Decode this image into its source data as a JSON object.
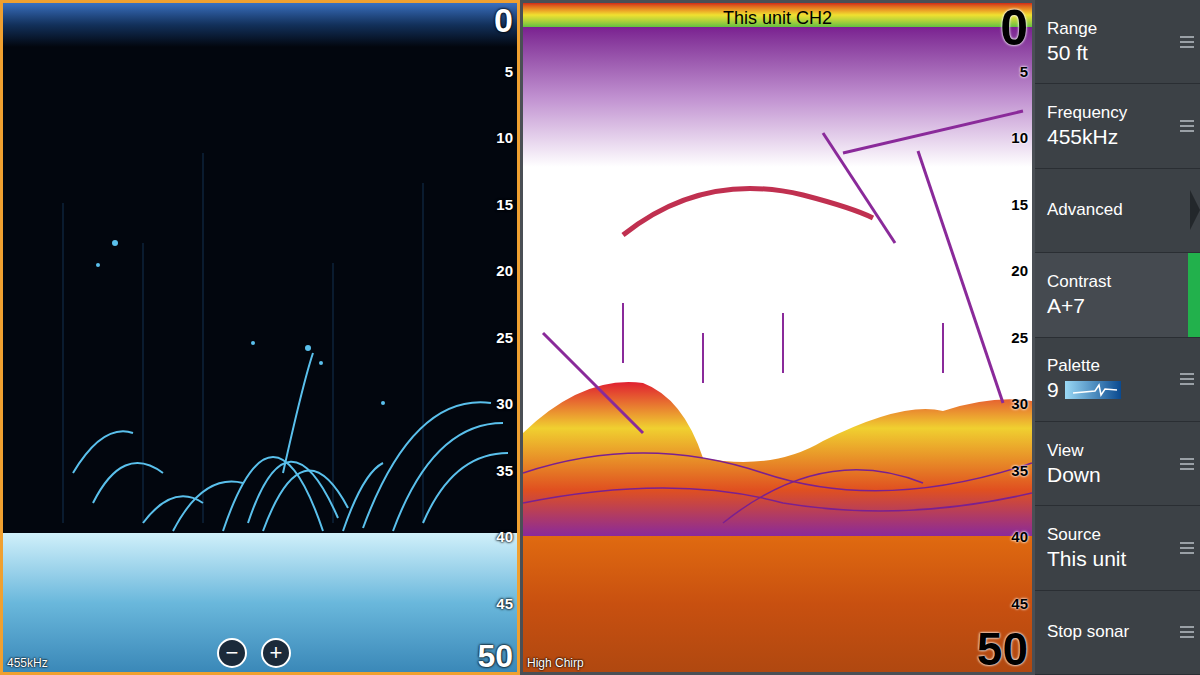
{
  "panes": [
    {
      "top_depth": "0",
      "bottom_depth": "50",
      "ticks": [
        "5",
        "10",
        "15",
        "20",
        "25",
        "30",
        "35",
        "40",
        "45"
      ],
      "footer": "455kHz",
      "zoom": [
        "−",
        "+"
      ],
      "selected": true
    },
    {
      "title": "This unit CH2",
      "top_depth": "0",
      "bottom_depth": "50",
      "ticks": [
        "5",
        "10",
        "15",
        "20",
        "25",
        "30",
        "35",
        "40",
        "45"
      ],
      "footer": "High Chirp",
      "selected": false
    }
  ],
  "menu": {
    "items": [
      {
        "label": "Range",
        "value": "50 ft",
        "kind": "value",
        "selected": false
      },
      {
        "label": "Frequency",
        "value": "455kHz",
        "kind": "value",
        "selected": false
      },
      {
        "label": "Advanced",
        "kind": "link",
        "selected": false
      },
      {
        "label": "Contrast",
        "value": "A+7",
        "kind": "value",
        "selected": true
      },
      {
        "label": "Palette",
        "value": "9",
        "kind": "palette",
        "selected": false
      },
      {
        "label": "View",
        "value": "Down",
        "kind": "value",
        "selected": false
      },
      {
        "label": "Source",
        "value": "This unit",
        "kind": "value",
        "selected": false
      },
      {
        "label": "Stop sonar",
        "kind": "action",
        "selected": false
      }
    ]
  }
}
